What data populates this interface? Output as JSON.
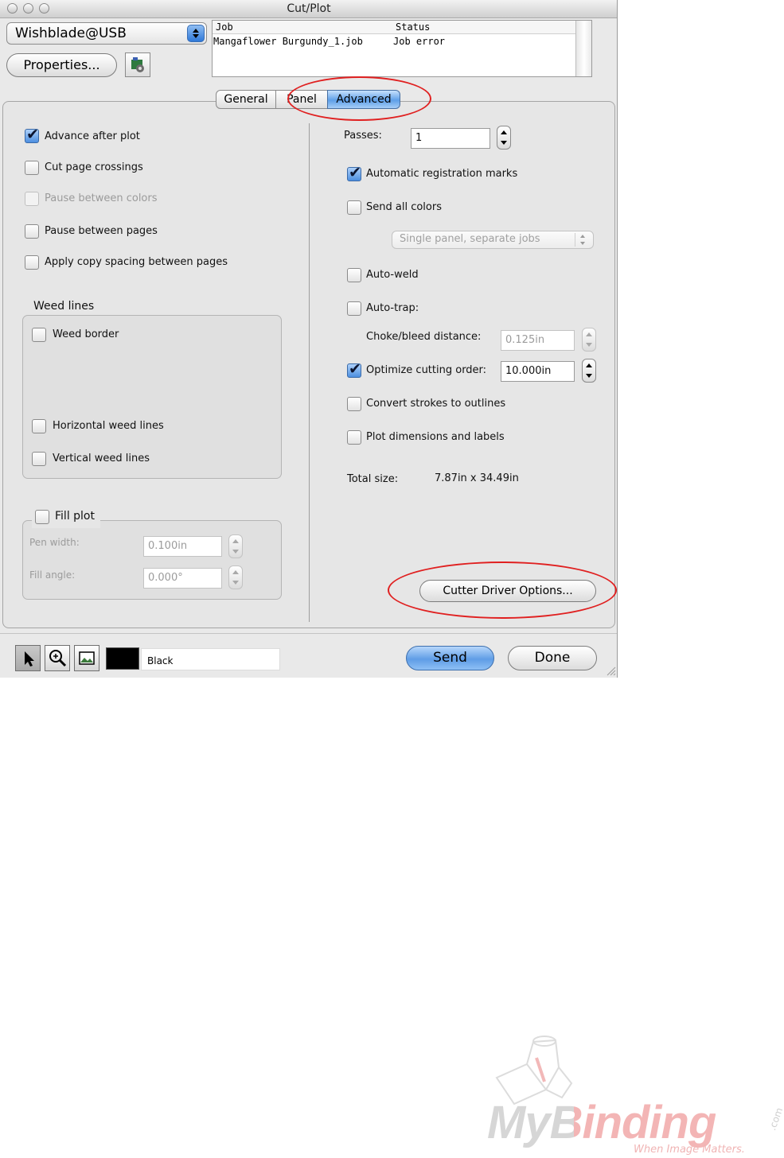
{
  "window": {
    "title": "Cut/Plot"
  },
  "device": {
    "selected": "Wishblade@USB"
  },
  "buttons": {
    "properties": "Properties...",
    "cutter_driver_options": "Cutter Driver Options...",
    "send": "Send",
    "done": "Done"
  },
  "job_list": {
    "headers": [
      "Job",
      "Status"
    ],
    "rows": [
      {
        "job": "Mangaflower Burgundy_1.job",
        "status": "Job error"
      }
    ]
  },
  "tabs": [
    {
      "label": "General",
      "active": false
    },
    {
      "label": "Panel",
      "active": false
    },
    {
      "label": "Advanced",
      "active": true
    }
  ],
  "left": {
    "options": [
      {
        "label": "Advance after plot",
        "checked": true,
        "enabled": true
      },
      {
        "label": "Cut page crossings",
        "checked": false,
        "enabled": true
      },
      {
        "label": "Pause between colors",
        "checked": false,
        "enabled": false
      },
      {
        "label": "Pause between pages",
        "checked": false,
        "enabled": true
      },
      {
        "label": "Apply copy spacing between pages",
        "checked": false,
        "enabled": true
      }
    ],
    "weed_lines": {
      "title": "Weed lines",
      "weed_border": "Weed border",
      "horizontal": "Horizontal weed lines",
      "vertical": "Vertical weed lines"
    },
    "fill_plot": {
      "title": "Fill plot",
      "pen_width_label": "Pen width:",
      "pen_width": "0.100in",
      "fill_angle_label": "Fill angle:",
      "fill_angle": "0.000°"
    }
  },
  "right": {
    "passes_label": "Passes:",
    "passes": "1",
    "auto_reg": "Automatic registration marks",
    "send_all_colors": "Send all colors",
    "panel_mode": "Single panel, separate jobs",
    "auto_weld": "Auto-weld",
    "auto_trap": "Auto-trap:",
    "choke_label": "Choke/bleed distance:",
    "choke_value": "0.125in",
    "optimize_label": "Optimize cutting order:",
    "optimize_value": "10.000in",
    "convert_strokes": "Convert strokes to outlines",
    "plot_dims": "Plot dimensions and labels",
    "total_size_label": "Total size:",
    "total_size": "7.87in x 34.49in"
  },
  "status_bar": {
    "color_name": "Black",
    "color_swatch": "#000000"
  },
  "logo": {
    "brand": "MyBinding",
    "suffix": ".com",
    "tagline": "When Image Matters."
  }
}
